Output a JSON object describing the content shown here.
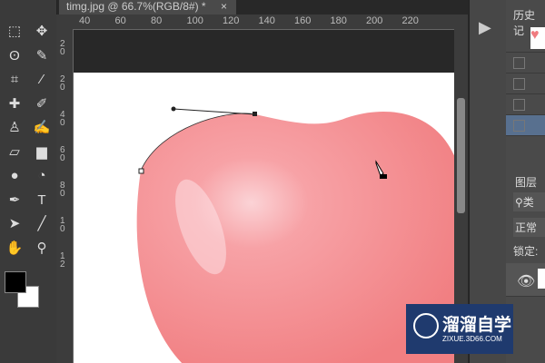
{
  "document_tab": {
    "title": "timg.jpg @ 66.7%(RGB/8#) *",
    "close": "×"
  },
  "ruler": {
    "h_labels": [
      "40",
      "60",
      "80",
      "100",
      "120",
      "140",
      "160",
      "180",
      "200",
      "220"
    ],
    "v_labels": [
      "20",
      "20",
      "40",
      "60",
      "80",
      "10",
      "12"
    ]
  },
  "tools": [
    {
      "name": "marquee",
      "glyph": "⬚"
    },
    {
      "name": "move",
      "glyph": "✥"
    },
    {
      "name": "lasso",
      "glyph": "ʘ"
    },
    {
      "name": "quick-select",
      "glyph": "✎"
    },
    {
      "name": "crop",
      "glyph": "⌗"
    },
    {
      "name": "eyedropper",
      "glyph": "⁄"
    },
    {
      "name": "healing",
      "glyph": "✚"
    },
    {
      "name": "brush",
      "glyph": "✐"
    },
    {
      "name": "stamp",
      "glyph": "♙"
    },
    {
      "name": "history-brush",
      "glyph": "✍"
    },
    {
      "name": "eraser",
      "glyph": "▱"
    },
    {
      "name": "gradient",
      "glyph": "▆"
    },
    {
      "name": "blur",
      "glyph": "●"
    },
    {
      "name": "dodge",
      "glyph": "◔"
    },
    {
      "name": "pen",
      "glyph": "✒"
    },
    {
      "name": "type",
      "glyph": "T"
    },
    {
      "name": "path-select",
      "glyph": "➤"
    },
    {
      "name": "line",
      "glyph": "╱"
    },
    {
      "name": "hand",
      "glyph": "✋"
    },
    {
      "name": "zoom",
      "glyph": "⚲"
    }
  ],
  "colors": {
    "foreground": "#000000",
    "background": "#ffffff",
    "heart": "#f48a8a",
    "watermark_bg": "#1f3a6e"
  },
  "history_panel": {
    "title": "历史记"
  },
  "layers_panel": {
    "title": "图层",
    "search": "类",
    "blend_mode": "正常",
    "lock_label": "锁定:"
  },
  "watermark": {
    "name": "溜溜自学",
    "url": "ZIXUE.3D66.COM"
  }
}
